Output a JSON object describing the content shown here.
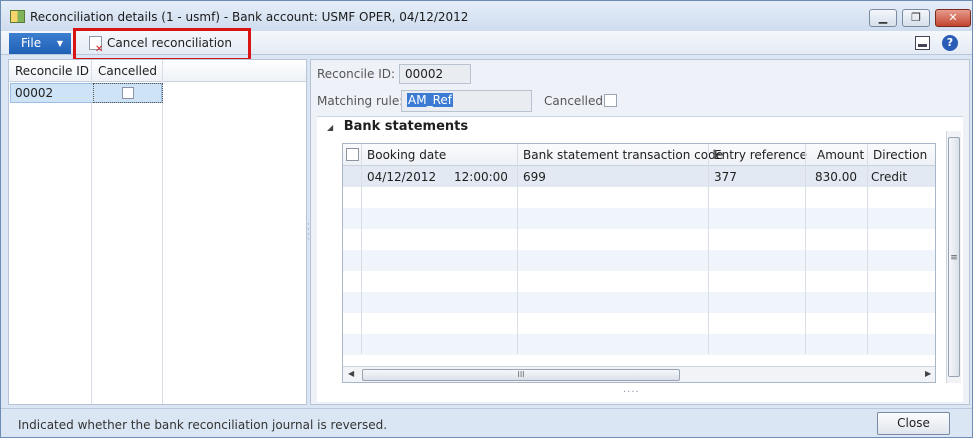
{
  "window": {
    "title": "Reconciliation details (1 - usmf) - Bank account: USMF OPER, 04/12/2012",
    "controls": {
      "minimize": "▁",
      "restore": "❐",
      "close": "✕"
    }
  },
  "menu": {
    "file_label": "File",
    "cancel_reconciliation_label": "Cancel reconciliation"
  },
  "left_grid": {
    "columns": [
      "Reconcile ID",
      "Cancelled"
    ],
    "rows": [
      {
        "reconcile_id": "00002",
        "cancelled": false
      }
    ]
  },
  "form": {
    "reconcile_id_label": "Reconcile ID:",
    "reconcile_id_value": "00002",
    "matching_rule_label": "Matching rule:",
    "matching_rule_value": "AM_Ref",
    "cancelled_label": "Cancelled:",
    "cancelled_value": false
  },
  "bank_statements": {
    "section_title": "Bank statements",
    "columns": [
      "Booking date",
      "Bank statement transaction code",
      "Entry reference",
      "Amount",
      "Direction"
    ],
    "rows": [
      {
        "booking_date": "04/12/2012",
        "booking_time": "12:00:00",
        "transaction_code": "699",
        "entry_reference": "377",
        "amount": "830.00",
        "direction": "Credit"
      }
    ],
    "hscroll_grip": "III",
    "vscroll_grip": "≡"
  },
  "status": {
    "message": "Indicated whether the bank reconciliation journal is reversed.",
    "close_label": "Close"
  },
  "colors": {
    "accent": "#1f5fb5",
    "highlight": "#d81414"
  }
}
